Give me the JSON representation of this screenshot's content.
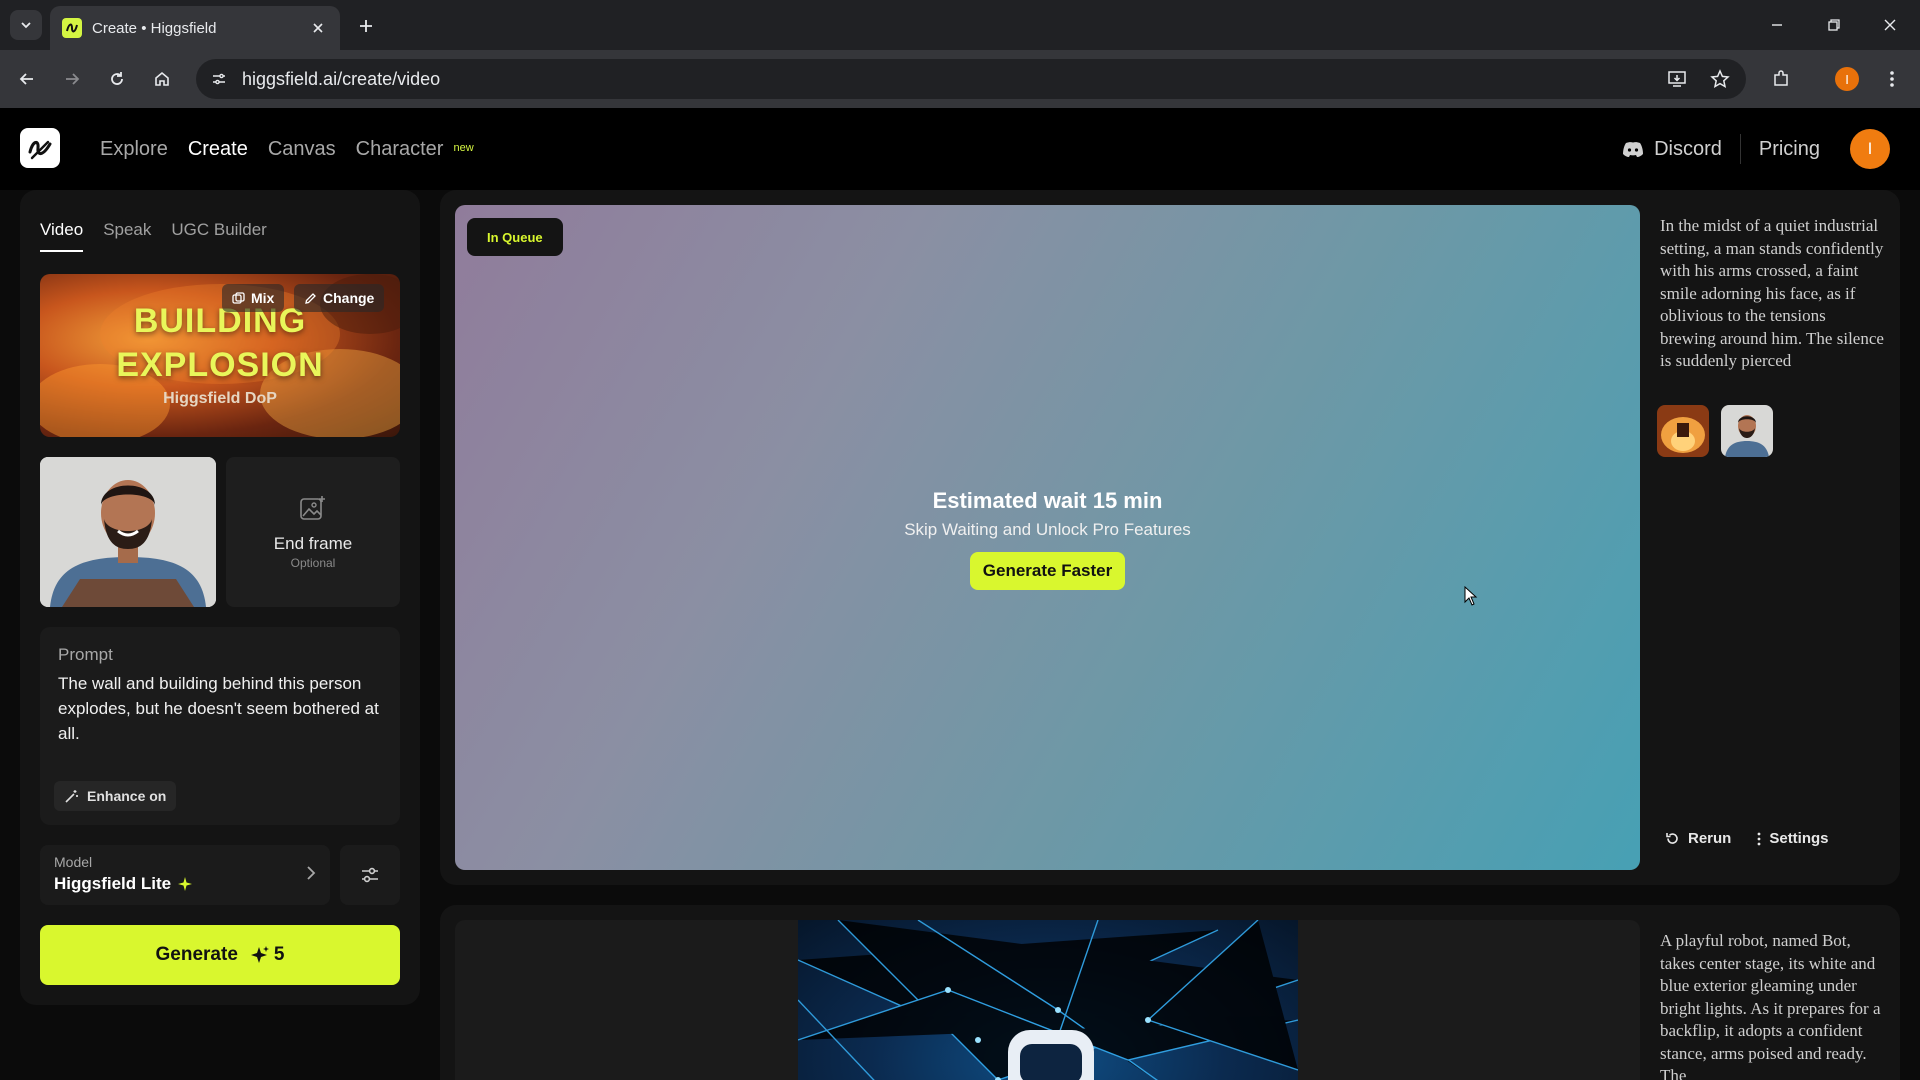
{
  "browser": {
    "tab_title": "Create • Higgsfield",
    "url": "higgsfield.ai/create/video",
    "profile_initial": "I"
  },
  "header": {
    "nav": [
      "Explore",
      "Create",
      "Canvas",
      "Character"
    ],
    "active_nav": "Create",
    "character_badge": "new",
    "discord": "Discord",
    "pricing": "Pricing",
    "avatar_initial": "I"
  },
  "left": {
    "tabs": [
      "Video",
      "Speak",
      "UGC Builder"
    ],
    "active_tab": "Video",
    "preset": {
      "title_line1": "BUILDING",
      "title_line2": "EXPLOSION",
      "subtitle": "Higgsfield DoP",
      "mix_label": "Mix",
      "change_label": "Change"
    },
    "end_frame": {
      "label": "End frame",
      "sub": "Optional"
    },
    "prompt": {
      "label": "Prompt",
      "text": "The wall and building behind this person explodes, but he doesn't seem bothered at all.",
      "enhance_label": "Enhance on"
    },
    "model": {
      "label": "Model",
      "value": "Higgsfield Lite"
    },
    "generate": {
      "label": "Generate",
      "cost": "5"
    }
  },
  "feed": {
    "card1": {
      "status": "In Queue",
      "wait_title": "Estimated wait 15 min",
      "wait_sub": "Skip Waiting and Unlock Pro Features",
      "faster_btn": "Generate Faster",
      "description": "In the midst of a quiet industrial setting, a man stands confidently with his arms crossed, a faint smile adorning his face, as if oblivious to the tensions brewing around him. The silence is suddenly pierced",
      "rerun": "Rerun",
      "settings": "Settings"
    },
    "card2": {
      "description": "A playful robot, named Bot, takes center stage, its white and blue exterior gleaming under bright lights. As it prepares for a backflip, it adopts a confident stance, arms poised and ready. The"
    }
  },
  "colors": {
    "accent": "#d9f72e",
    "avatar": "#f07c10",
    "panel": "#141414"
  }
}
